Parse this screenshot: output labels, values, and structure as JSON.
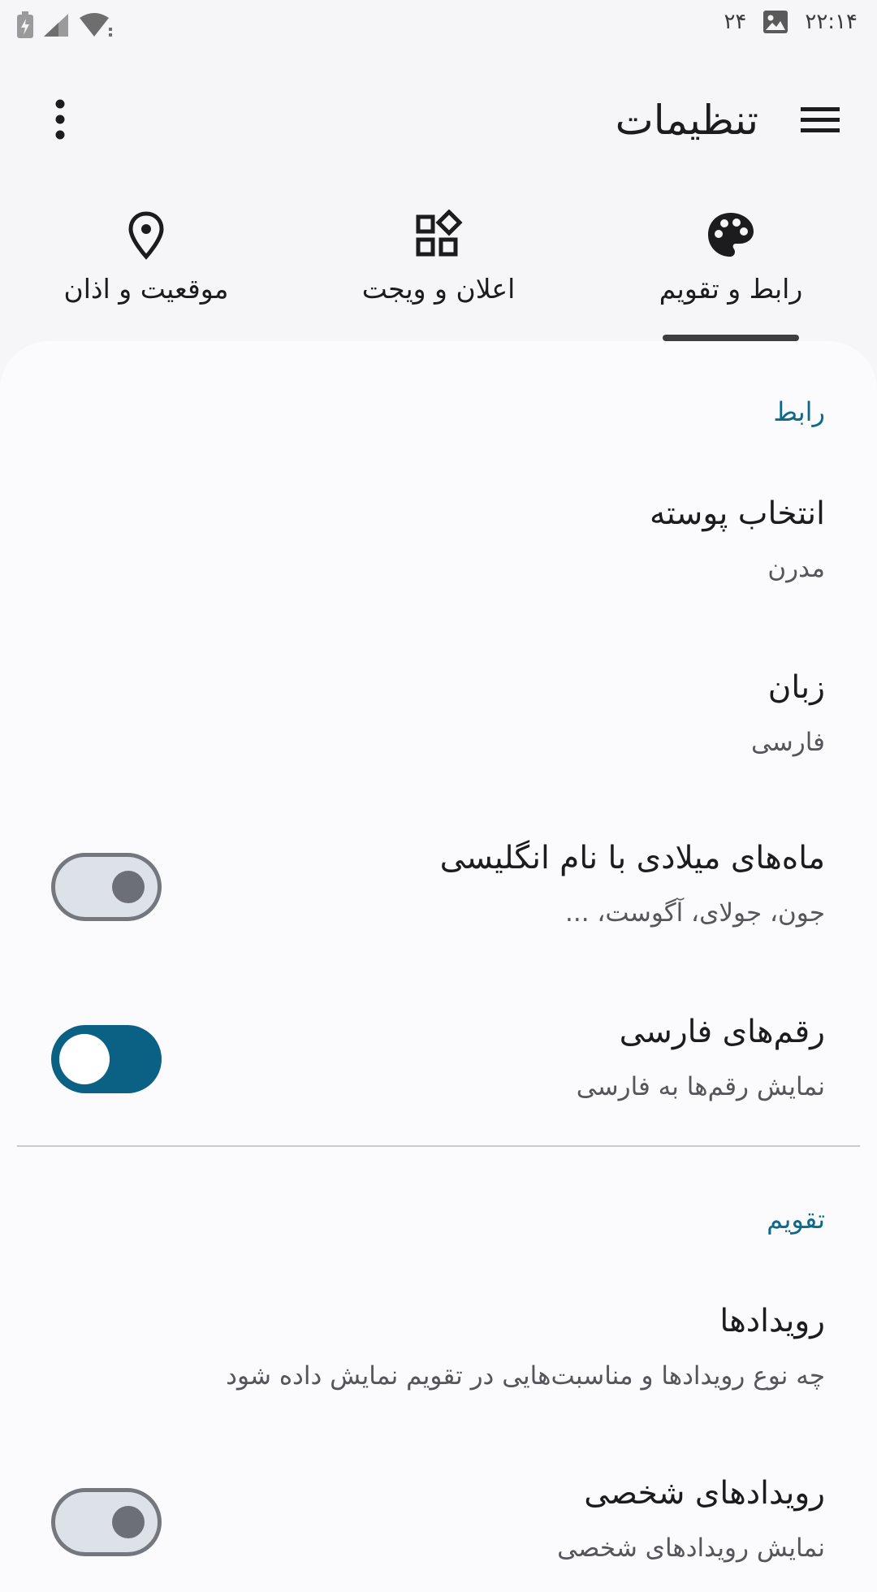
{
  "status_bar": {
    "time": "۲۲:۱۴",
    "date": "۲۴",
    "icons": [
      "battery-charging-icon",
      "signal-icon",
      "wifi-icon",
      "image-icon"
    ]
  },
  "app_bar": {
    "title": "تنظیمات",
    "menu_icon": "menu-icon",
    "more_icon": "more-vert-icon"
  },
  "tabs": [
    {
      "label": "رابط و تقویم",
      "icon": "palette-icon",
      "selected": true
    },
    {
      "label": "اعلان و ویجت",
      "icon": "widgets-icon",
      "selected": false
    },
    {
      "label": "موقعیت و اذان",
      "icon": "location-pin-icon",
      "selected": false
    }
  ],
  "sections": {
    "interface": {
      "header": "رابط",
      "items": [
        {
          "title": "انتخاب پوسته",
          "summary": "مدرن"
        },
        {
          "title": "زبان",
          "summary": "فارسی"
        },
        {
          "title": "ماه‌های میلادی با نام انگلیسی",
          "summary": "جون، جولای، آگوست، ...",
          "switch_on": false
        },
        {
          "title": "رقم‌های فارسی",
          "summary": "نمایش رقم‌ها به فارسی",
          "switch_on": true
        }
      ]
    },
    "calendar": {
      "header": "تقویم",
      "items": [
        {
          "title": "رویدادها",
          "summary": "چه نوع رویدادها و مناسبت‌هایی در تقویم نمایش داده شود"
        },
        {
          "title": "رویدادهای شخصی",
          "summary": "نمایش رویدادهای شخصی",
          "switch_on": false
        }
      ]
    }
  },
  "colors": {
    "accent": "#0a6184",
    "section_header": "#0e6a8a",
    "background": "#f6f6f8",
    "sheet": "#fbfbfd"
  }
}
